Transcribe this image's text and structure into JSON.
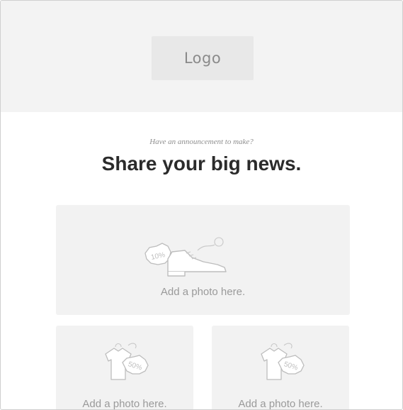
{
  "header": {
    "logo_label": "Logo"
  },
  "hero": {
    "tagline": "Have an announcement to make?",
    "headline": "Share your big news."
  },
  "cards": [
    {
      "label": "Add a photo here.",
      "icon": "shoe-sale-icon",
      "badge": "10%"
    },
    {
      "label": "Add a photo here.",
      "icon": "shirt-sale-icon",
      "badge": "50%"
    },
    {
      "label": "Add a photo here.",
      "icon": "shirt-sale-icon",
      "badge": "50%"
    }
  ],
  "colors": {
    "header_bg": "#f3f3f3",
    "card_bg": "#f2f2f2",
    "headline": "#2b2b2b",
    "muted_text": "#9a9a9a"
  }
}
